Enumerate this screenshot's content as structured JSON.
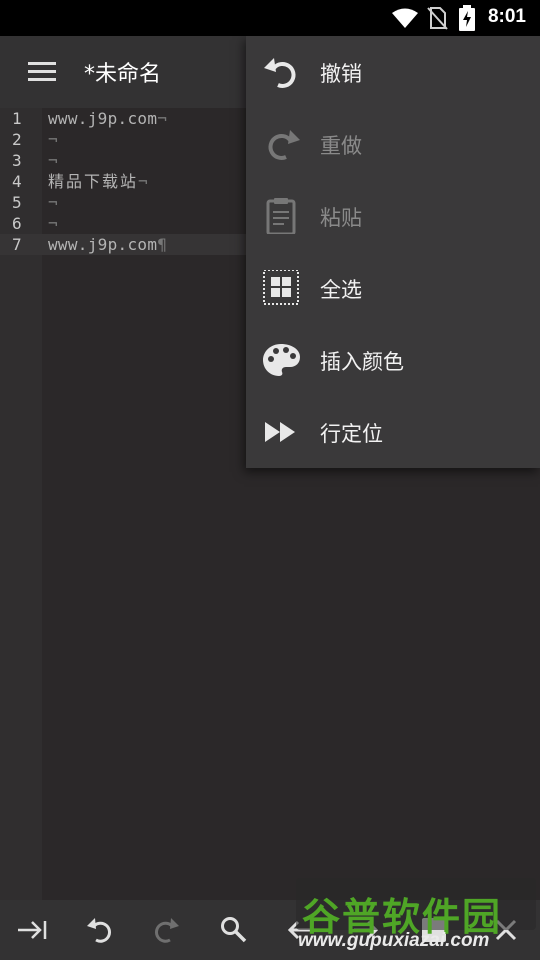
{
  "status_bar": {
    "time": "8:01",
    "icons": [
      "wifi-icon",
      "no-sim-icon",
      "battery-charging-icon"
    ]
  },
  "toolbar": {
    "menu_icon": "hamburger-menu-icon",
    "title": "*未命名"
  },
  "editor": {
    "lines": [
      {
        "number": "1",
        "text": "www.j9p.com",
        "mark": "¬"
      },
      {
        "number": "2",
        "text": "",
        "mark": "¬"
      },
      {
        "number": "3",
        "text": "",
        "mark": "¬"
      },
      {
        "number": "4",
        "text": "精品下载站",
        "mark": "¬"
      },
      {
        "number": "5",
        "text": "",
        "mark": "¬"
      },
      {
        "number": "6",
        "text": "",
        "mark": "¬"
      },
      {
        "number": "7",
        "text": "www.j9p.com",
        "mark": "¶"
      }
    ],
    "current_line": 7
  },
  "popup_menu": {
    "items": [
      {
        "label": "撤销",
        "icon": "undo-icon",
        "enabled": true
      },
      {
        "label": "重做",
        "icon": "redo-icon",
        "enabled": false
      },
      {
        "label": "粘贴",
        "icon": "clipboard-icon",
        "enabled": false
      },
      {
        "label": "全选",
        "icon": "select-all-icon",
        "enabled": true
      },
      {
        "label": "插入颜色",
        "icon": "palette-icon",
        "enabled": true
      },
      {
        "label": "行定位",
        "icon": "fast-forward-icon",
        "enabled": true
      }
    ]
  },
  "bottom_bar": {
    "icons": [
      "tab-icon",
      "undo-icon",
      "redo-icon",
      "search-icon",
      "arrow-left-icon",
      "arrow-right-icon",
      "save-icon",
      "close-icon"
    ]
  },
  "watermark": {
    "name": "谷普软件园",
    "url": "www.gupuxiazai.com"
  },
  "colors": {
    "background": "#2b2829",
    "toolbar": "#333233",
    "popup": "#3a393a",
    "watermark_green": "#4fa626"
  }
}
